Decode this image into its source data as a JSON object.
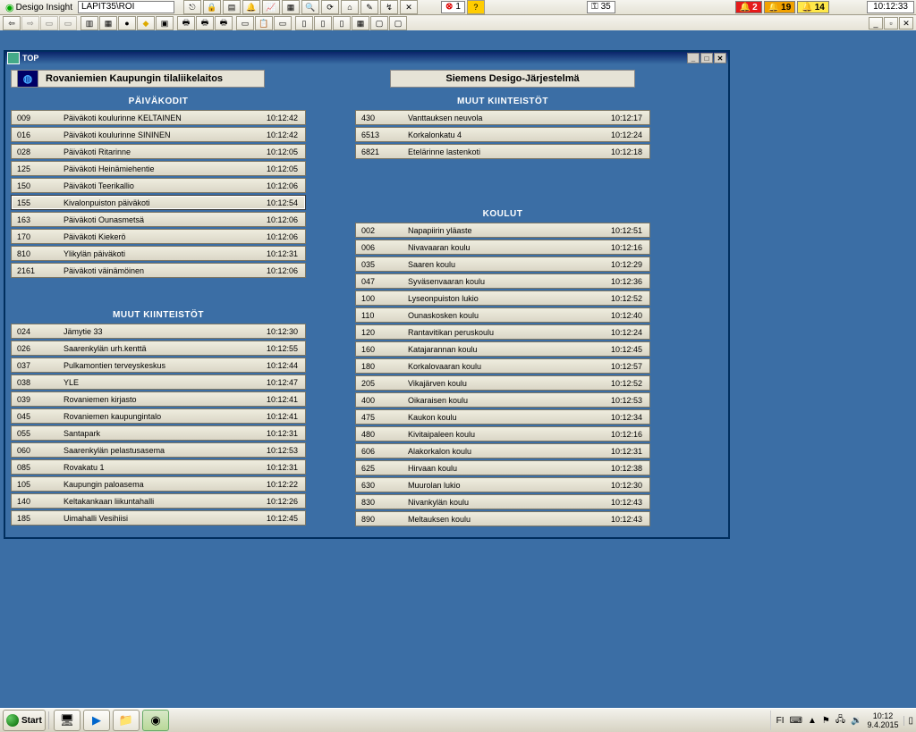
{
  "app": {
    "name": "Desigo Insight",
    "path": "LAPIT35\\ROI"
  },
  "statusbar": {
    "error_count": "1",
    "key_count": "35",
    "alarm_red": "2",
    "alarm_orange": "19",
    "alarm_yellow": "14",
    "clock": "10:12:33"
  },
  "docwin": {
    "title": "TOP",
    "hdr_left": "Rovaniemien Kaupungin tilaliikelaitos",
    "hdr_right": "Siemens Desigo-Järjestelmä"
  },
  "sections": {
    "paivakodit": {
      "title": "PÄIVÄKODIT",
      "rows": [
        {
          "id": "009",
          "label": "Päiväkoti koulurinne   KELTAINEN",
          "time": "10:12:42"
        },
        {
          "id": "016",
          "label": "Päiväkoti koulurinne   SININEN",
          "time": "10:12:42"
        },
        {
          "id": "028",
          "label": "Päiväkoti Ritarinne",
          "time": "10:12:05"
        },
        {
          "id": "125",
          "label": "Päiväkoti Heinämiehentie",
          "time": "10:12:05"
        },
        {
          "id": "150",
          "label": "Päiväkoti Teerikallio",
          "time": "10:12:06"
        },
        {
          "id": "155",
          "label": "Kivalonpuiston päiväkoti",
          "time": "10:12:54"
        },
        {
          "id": "163",
          "label": "Päiväkoti Ounasmetsä",
          "time": "10:12:06"
        },
        {
          "id": "170",
          "label": "Päiväkoti Kiekerö",
          "time": "10:12:06"
        },
        {
          "id": "810",
          "label": "Ylikylän päiväkoti",
          "time": "10:12:31"
        },
        {
          "id": "2161",
          "label": "Päiväkoti väinämöinen",
          "time": "10:12:06"
        }
      ]
    },
    "muut1": {
      "title": "MUUT KIINTEISTÖT",
      "rows": [
        {
          "id": "024",
          "label": "Jämytie 33",
          "time": "10:12:30"
        },
        {
          "id": "026",
          "label": "Saarenkylän urh.kenttä",
          "time": "10:12:55"
        },
        {
          "id": "037",
          "label": "Pulkamontien terveyskeskus",
          "time": "10:12:44"
        },
        {
          "id": "038",
          "label": "YLE",
          "time": "10:12:47"
        },
        {
          "id": "039",
          "label": "Rovaniemen kirjasto",
          "time": "10:12:41"
        },
        {
          "id": "045",
          "label": "Rovaniemen kaupungintalo",
          "time": "10:12:41"
        },
        {
          "id": "055",
          "label": "Santapark",
          "time": "10:12:31"
        },
        {
          "id": "060",
          "label": "Saarenkylän pelastusasema",
          "time": "10:12:53"
        },
        {
          "id": "085",
          "label": "Rovakatu 1",
          "time": "10:12:31"
        },
        {
          "id": "105",
          "label": "Kaupungin paloasema",
          "time": "10:12:22"
        },
        {
          "id": "140",
          "label": "Keltakankaan liikuntahalli",
          "time": "10:12:26"
        },
        {
          "id": "185",
          "label": "Uimahalli Vesihiisi",
          "time": "10:12:45"
        }
      ]
    },
    "muut2": {
      "title": "MUUT KIINTEISTÖT",
      "rows": [
        {
          "id": "430",
          "label": "Vanttauksen neuvola",
          "time": "10:12:17"
        },
        {
          "id": "6513",
          "label": "Korkalonkatu 4",
          "time": "10:12:24"
        },
        {
          "id": "6821",
          "label": "Etelärinne lastenkoti",
          "time": "10:12:18"
        }
      ]
    },
    "koulut": {
      "title": "KOULUT",
      "rows": [
        {
          "id": "002",
          "label": "Napapiirin yläaste",
          "time": "10:12:51"
        },
        {
          "id": "006",
          "label": "Nivavaaran koulu",
          "time": "10:12:16"
        },
        {
          "id": "035",
          "label": "Saaren koulu",
          "time": "10:12:29"
        },
        {
          "id": "047",
          "label": "Syväsenvaaran koulu",
          "time": "10:12:36"
        },
        {
          "id": "100",
          "label": "Lyseonpuiston lukio",
          "time": "10:12:52"
        },
        {
          "id": "110",
          "label": "Ounaskosken koulu",
          "time": "10:12:40"
        },
        {
          "id": "120",
          "label": "Rantavitikan peruskoulu",
          "time": "10:12:24"
        },
        {
          "id": "160",
          "label": "Katajarannan koulu",
          "time": "10:12:45"
        },
        {
          "id": "180",
          "label": "Korkalovaaran koulu",
          "time": "10:12:57"
        },
        {
          "id": "205",
          "label": "Vikajärven koulu",
          "time": "10:12:52"
        },
        {
          "id": "400",
          "label": "Oikaraisen koulu",
          "time": "10:12:53"
        },
        {
          "id": "475",
          "label": "Kaukon koulu",
          "time": "10:12:34"
        },
        {
          "id": "480",
          "label": "Kivitaipaleen koulu",
          "time": "10:12:16"
        },
        {
          "id": "606",
          "label": "Alakorkalon koulu",
          "time": "10:12:31"
        },
        {
          "id": "625",
          "label": "Hirvaan koulu",
          "time": "10:12:38"
        },
        {
          "id": "630",
          "label": "Muurolan lukio",
          "time": "10:12:30"
        },
        {
          "id": "830",
          "label": "Nivankylän koulu",
          "time": "10:12:43"
        },
        {
          "id": "890",
          "label": "Meltauksen koulu",
          "time": "10:12:43"
        }
      ]
    }
  },
  "taskbar": {
    "start": "Start",
    "lang": "FI",
    "clock_time": "10:12",
    "clock_date": "9.4.2015"
  }
}
